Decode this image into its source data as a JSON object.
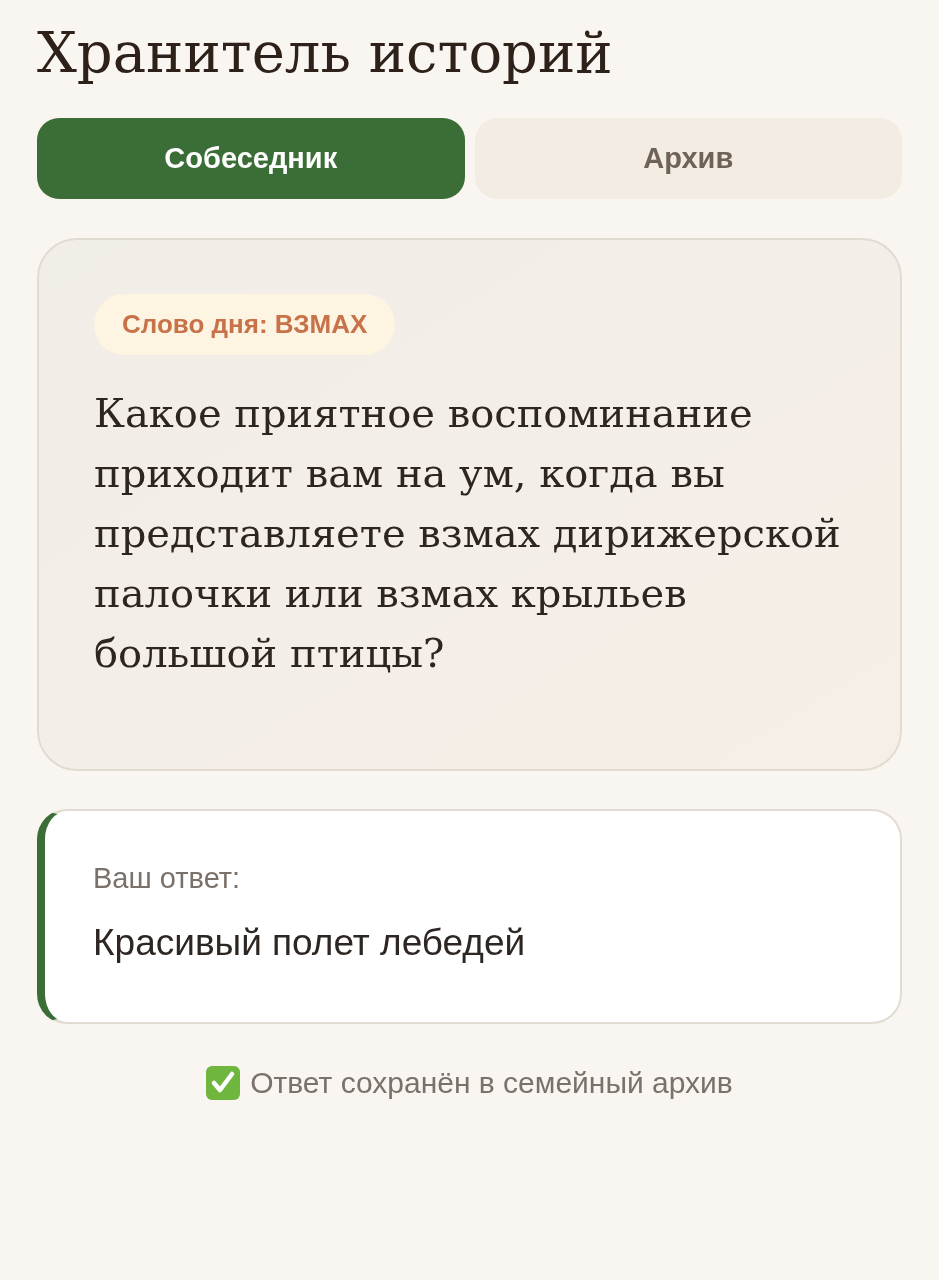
{
  "title": "Хранитель историй",
  "tabs": [
    {
      "label": "Собеседник",
      "selected": true
    },
    {
      "label": "Архив",
      "selected": false
    }
  ],
  "question_card": {
    "badge": "Слово дня: ВЗМАХ",
    "question": "Какое приятное воспоминание приходит вам на ум, когда вы представляете взмах дирижерской палочки или взмах крыльев большой птицы?"
  },
  "answer": {
    "label": "Ваш ответ:",
    "value": "Красивый полет лебедей"
  },
  "status": {
    "saved": true,
    "text": "Ответ сохранён в семейный архив"
  }
}
